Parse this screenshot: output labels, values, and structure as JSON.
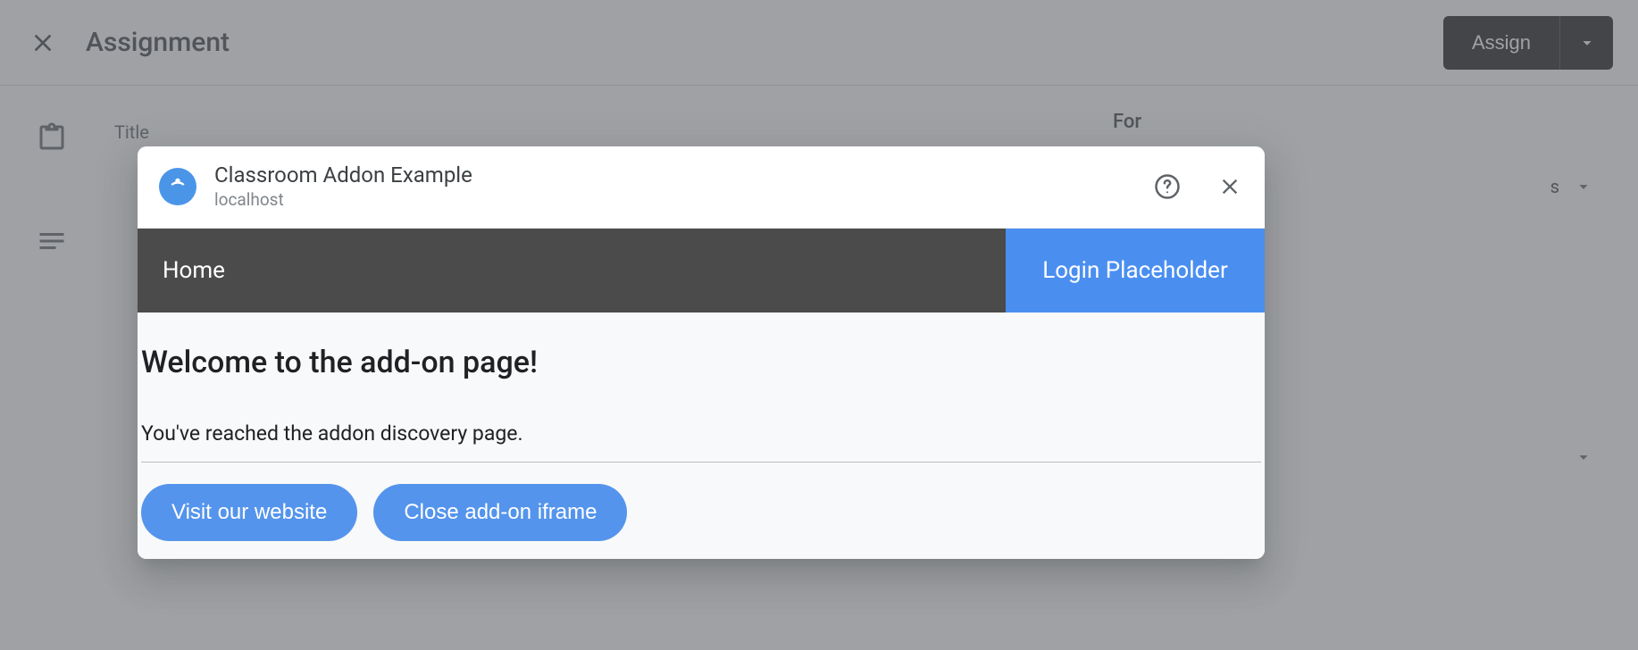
{
  "header": {
    "title": "Assignment",
    "assign_label": "Assign"
  },
  "background": {
    "title_label": "Title",
    "for_label": "For",
    "for_value_partial": "s"
  },
  "modal": {
    "title": "Classroom Addon Example",
    "subtitle": "localhost",
    "nav": {
      "home": "Home",
      "login": "Login Placeholder"
    },
    "content": {
      "heading": "Welcome to the add-on page!",
      "description": "You've reached the addon discovery page.",
      "visit_button": "Visit our website",
      "close_button": "Close add-on iframe"
    }
  }
}
